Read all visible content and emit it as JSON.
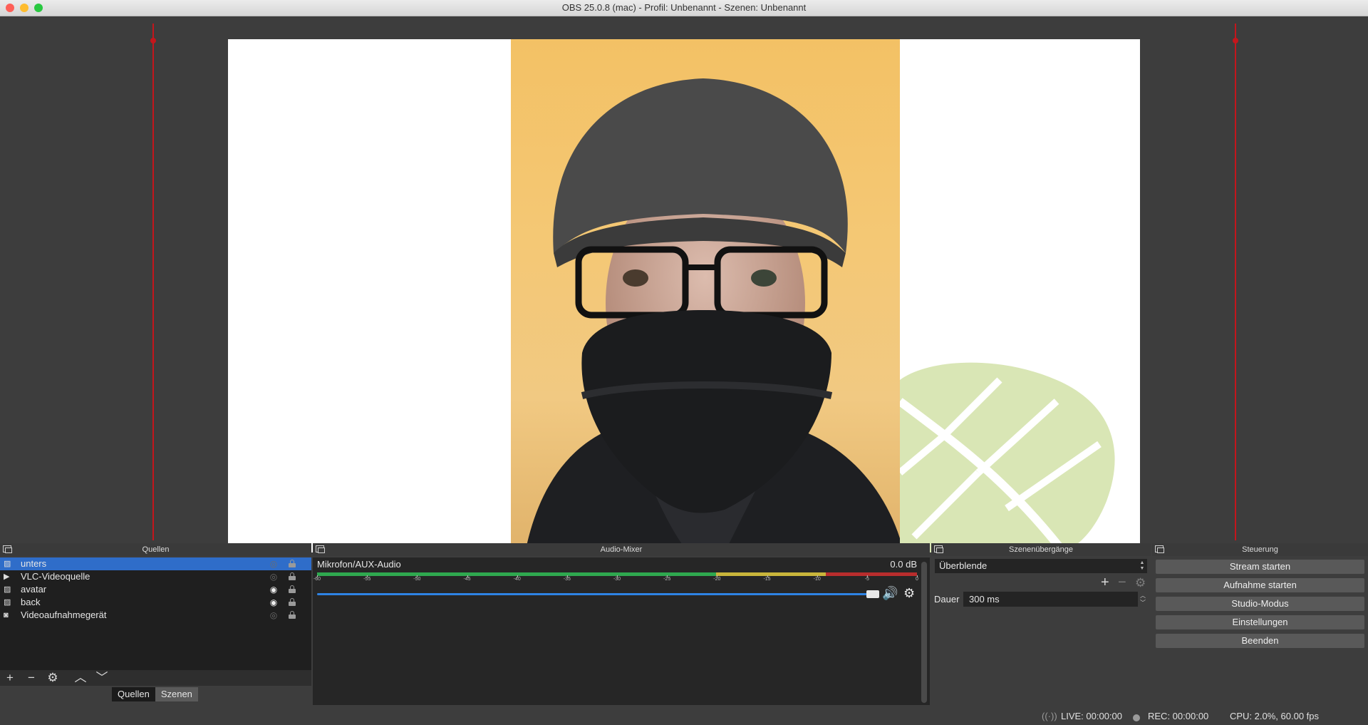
{
  "window": {
    "title": "OBS 25.0.8 (mac) - Profil: Unbenannt - Szenen: Unbenannt"
  },
  "sources": {
    "title": "Quellen",
    "items": [
      {
        "label": "unters",
        "icon": "image-icon",
        "visible": false,
        "selected": true
      },
      {
        "label": "VLC-Videoquelle",
        "icon": "play-icon",
        "visible": false,
        "selected": false
      },
      {
        "label": "avatar",
        "icon": "image-icon",
        "visible": true,
        "selected": false
      },
      {
        "label": "back",
        "icon": "image-icon",
        "visible": true,
        "selected": false
      },
      {
        "label": "Videoaufnahmegerät",
        "icon": "camera-icon",
        "visible": false,
        "selected": false
      }
    ],
    "tabs": [
      "Quellen",
      "Szenen"
    ]
  },
  "mixer": {
    "title": "Audio-Mixer",
    "channel": {
      "name": "Mikrofon/AUX-Audio",
      "level": "0.0 dB",
      "ticks": [
        "-60",
        "-55",
        "-50",
        "-45",
        "-40",
        "-35",
        "-30",
        "-25",
        "-20",
        "-15",
        "-10",
        "-5",
        "0"
      ],
      "volume_fraction": 1.0
    }
  },
  "transitions": {
    "title": "Szenenübergänge",
    "selected": "Überblende",
    "duration_label": "Dauer",
    "duration_value": "300 ms"
  },
  "controls": {
    "title": "Steuerung",
    "buttons": [
      "Stream starten",
      "Aufnahme starten",
      "Studio-Modus",
      "Einstellungen",
      "Beenden"
    ]
  },
  "status": {
    "live": "LIVE: 00:00:00",
    "rec": "REC: 00:00:00",
    "cpu": "CPU: 2.0%, 60.00 fps"
  },
  "colors": {
    "selection": "#2f6dc9",
    "guide": "#c4161c",
    "meter_green": "#2fa84f",
    "meter_yellow": "#c9b53b",
    "meter_red": "#b82d2d",
    "volume": "#2e83e4"
  }
}
